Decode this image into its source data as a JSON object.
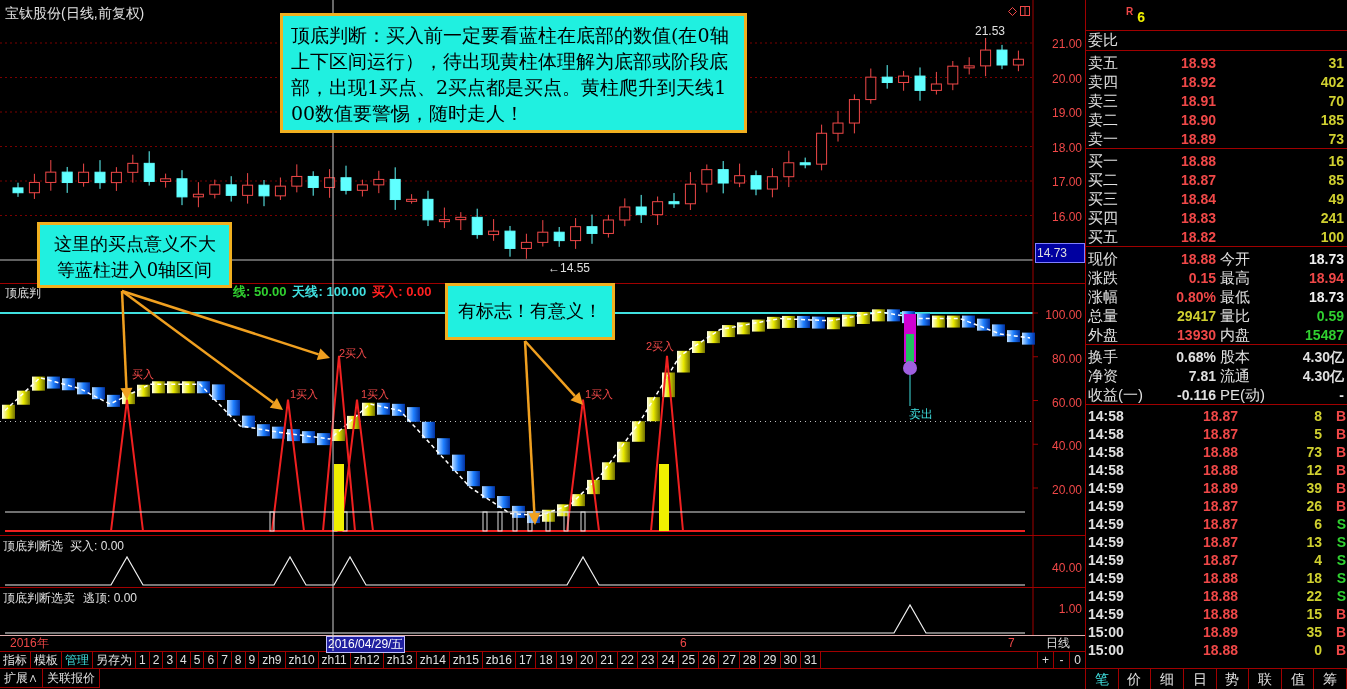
{
  "chart_title": "宝钛股份(日线,前复权)",
  "price_axis": [
    "21.00",
    "20.00",
    "19.00",
    "18.00",
    "17.00",
    "16.00"
  ],
  "current_price_tag": "14.73",
  "high_marker": "21.53",
  "low_marker": "←14.55",
  "annotations": [
    {
      "text": "顶底判断：买入前一定要看蓝柱在底部的数值(在0轴上下区间运行），待出现黄柱体理解为底部或阶段底部，出现1买点、2买点都是买点。黄柱爬升到天线100数值要警惕，随时走人！"
    },
    {
      "text": "这里的买点意义不大等蓝柱进入0轴区间"
    },
    {
      "text": "有标志！有意义！"
    }
  ],
  "indicator": {
    "label": "顶底判",
    "readings": [
      {
        "text": "线: 50.00",
        "color": "#30d030"
      },
      {
        "text": "天线: 100.00",
        "color": "#40e0e0"
      },
      {
        "text": "买入: 0.00",
        "color": "#ff2020"
      }
    ]
  },
  "indicator_axis": [
    "100.00",
    "80.00",
    "60.00",
    "40.00",
    "20.00"
  ],
  "signal_labels": [
    {
      "text": "买入"
    },
    {
      "text": "1买入"
    },
    {
      "text": "2买入"
    },
    {
      "text": "1买入"
    },
    {
      "text": "1买入"
    },
    {
      "text": "2买入"
    }
  ],
  "sell_label": "卖出",
  "sub_panels": [
    {
      "title": "顶底判断选",
      "reading": "买入: 0.00",
      "axis": "40.00"
    },
    {
      "title": "顶底判断选卖",
      "reading": "逃顶: 0.00",
      "axis": "1.00"
    }
  ],
  "date_axis": [
    {
      "text": "2016年",
      "selected": false
    },
    {
      "text": "2016/04/29/五",
      "selected": true
    },
    {
      "text": "6",
      "selected": false
    },
    {
      "text": "7",
      "selected": false
    }
  ],
  "period": "日线",
  "toolbar_tabs": [
    {
      "label": "指标",
      "selected": false
    },
    {
      "label": "模板",
      "selected": false
    },
    {
      "label": "管理",
      "selected": true
    },
    {
      "label": "另存为",
      "selected": false
    },
    {
      "label": "1",
      "selected": false
    },
    {
      "label": "2",
      "selected": false
    },
    {
      "label": "3",
      "selected": false
    },
    {
      "label": "4",
      "selected": false
    },
    {
      "label": "5",
      "selected": false
    },
    {
      "label": "6",
      "selected": false
    },
    {
      "label": "7",
      "selected": false
    },
    {
      "label": "8",
      "selected": false
    },
    {
      "label": "9",
      "selected": false
    },
    {
      "label": "zh9",
      "selected": false
    },
    {
      "label": "zh10",
      "selected": false
    },
    {
      "label": "zh11",
      "selected": false
    },
    {
      "label": "zh12",
      "selected": false
    },
    {
      "label": "zh13",
      "selected": false
    },
    {
      "label": "zh14",
      "selected": false
    },
    {
      "label": "zh15",
      "selected": false
    },
    {
      "label": "zb16",
      "selected": false
    },
    {
      "label": "17",
      "selected": false
    },
    {
      "label": "18",
      "selected": false
    },
    {
      "label": "19",
      "selected": false
    },
    {
      "label": "20",
      "selected": false
    },
    {
      "label": "21",
      "selected": false
    },
    {
      "label": "22",
      "selected": false
    },
    {
      "label": "23",
      "selected": false
    },
    {
      "label": "24",
      "selected": false
    },
    {
      "label": "25",
      "selected": false
    },
    {
      "label": "26",
      "selected": false
    },
    {
      "label": "27",
      "selected": false
    },
    {
      "label": "28",
      "selected": false
    },
    {
      "label": "29",
      "selected": false
    },
    {
      "label": "30",
      "selected": false
    },
    {
      "label": "31",
      "selected": false
    }
  ],
  "zoom_buttons": [
    "+",
    "-",
    "0"
  ],
  "bottom_buttons": [
    "扩展∧",
    "关联报价"
  ],
  "quote_flags": [
    "R",
    "6"
  ],
  "quote_label": "委比",
  "asks": [
    {
      "label": "卖五",
      "price": "18.93",
      "volume": "31"
    },
    {
      "label": "卖四",
      "price": "18.92",
      "volume": "402"
    },
    {
      "label": "卖三",
      "price": "18.91",
      "volume": "70"
    },
    {
      "label": "卖二",
      "price": "18.90",
      "volume": "185"
    },
    {
      "label": "卖一",
      "price": "18.89",
      "volume": "73"
    }
  ],
  "bids": [
    {
      "label": "买一",
      "price": "18.88",
      "volume": "16"
    },
    {
      "label": "买二",
      "price": "18.87",
      "volume": "85"
    },
    {
      "label": "买三",
      "price": "18.84",
      "volume": "49"
    },
    {
      "label": "买四",
      "price": "18.83",
      "volume": "241"
    },
    {
      "label": "买五",
      "price": "18.82",
      "volume": "100"
    }
  ],
  "stats": [
    {
      "left": {
        "label": "现价",
        "value": "18.88",
        "color": "#f04848"
      },
      "right": {
        "label": "今开",
        "value": "18.73",
        "color": "#f0f0f0"
      }
    },
    {
      "left": {
        "label": "涨跌",
        "value": "0.15",
        "color": "#f04848"
      },
      "right": {
        "label": "最高",
        "value": "18.94",
        "color": "#f04848"
      }
    },
    {
      "left": {
        "label": "涨幅",
        "value": "0.80%",
        "color": "#f04848"
      },
      "right": {
        "label": "最低",
        "value": "18.73",
        "color": "#f0f0f0"
      }
    },
    {
      "left": {
        "label": "总量",
        "value": "29417",
        "color": "#d0d030"
      },
      "right": {
        "label": "量比",
        "value": "0.59",
        "color": "#30d030"
      }
    },
    {
      "left": {
        "label": "外盘",
        "value": "13930",
        "color": "#f04848"
      },
      "right": {
        "label": "内盘",
        "value": "15487",
        "color": "#30d030"
      }
    }
  ],
  "fundamentals": [
    {
      "label": "换手",
      "value": "0.68%",
      "label2": "股本",
      "value2": "4.30亿"
    },
    {
      "label": "净资",
      "value": "7.81",
      "label2": "流通",
      "value2": "4.30亿"
    },
    {
      "label": "收益(一)",
      "value": "-0.116",
      "label2": "PE(动)",
      "value2": "-"
    }
  ],
  "ticks": [
    {
      "time": "14:58",
      "price": "18.87",
      "volume": "8",
      "side": "B",
      "kind": "buy"
    },
    {
      "time": "14:58",
      "price": "18.87",
      "volume": "5",
      "side": "B",
      "kind": "buy"
    },
    {
      "time": "14:58",
      "price": "18.88",
      "volume": "73",
      "side": "B",
      "kind": "buy"
    },
    {
      "time": "14:58",
      "price": "18.88",
      "volume": "12",
      "side": "B",
      "kind": "buy"
    },
    {
      "time": "14:59",
      "price": "18.89",
      "volume": "39",
      "side": "B",
      "kind": "buy"
    },
    {
      "time": "14:59",
      "price": "18.87",
      "volume": "26",
      "side": "B",
      "kind": "buy"
    },
    {
      "time": "14:59",
      "price": "18.87",
      "volume": "6",
      "side": "S",
      "kind": "sell"
    },
    {
      "time": "14:59",
      "price": "18.87",
      "volume": "13",
      "side": "S",
      "kind": "sell"
    },
    {
      "time": "14:59",
      "price": "18.87",
      "volume": "4",
      "side": "S",
      "kind": "sell"
    },
    {
      "time": "14:59",
      "price": "18.88",
      "volume": "18",
      "side": "S",
      "kind": "sell"
    },
    {
      "time": "14:59",
      "price": "18.88",
      "volume": "22",
      "side": "S",
      "kind": "sell"
    },
    {
      "time": "14:59",
      "price": "18.88",
      "volume": "15",
      "side": "B",
      "kind": "buy"
    },
    {
      "time": "15:00",
      "price": "18.89",
      "volume": "35",
      "side": "B",
      "kind": "buy"
    },
    {
      "time": "15:00",
      "price": "18.88",
      "volume": "0",
      "side": "B",
      "kind": "buy"
    }
  ],
  "panel_tabs": [
    {
      "label": "笔",
      "selected": true
    },
    {
      "label": "价",
      "selected": false
    },
    {
      "label": "细",
      "selected": false
    },
    {
      "label": "日",
      "selected": false
    },
    {
      "label": "势",
      "selected": false
    },
    {
      "label": "联",
      "selected": false
    },
    {
      "label": "值",
      "selected": false
    },
    {
      "label": "筹",
      "selected": false
    }
  ]
}
